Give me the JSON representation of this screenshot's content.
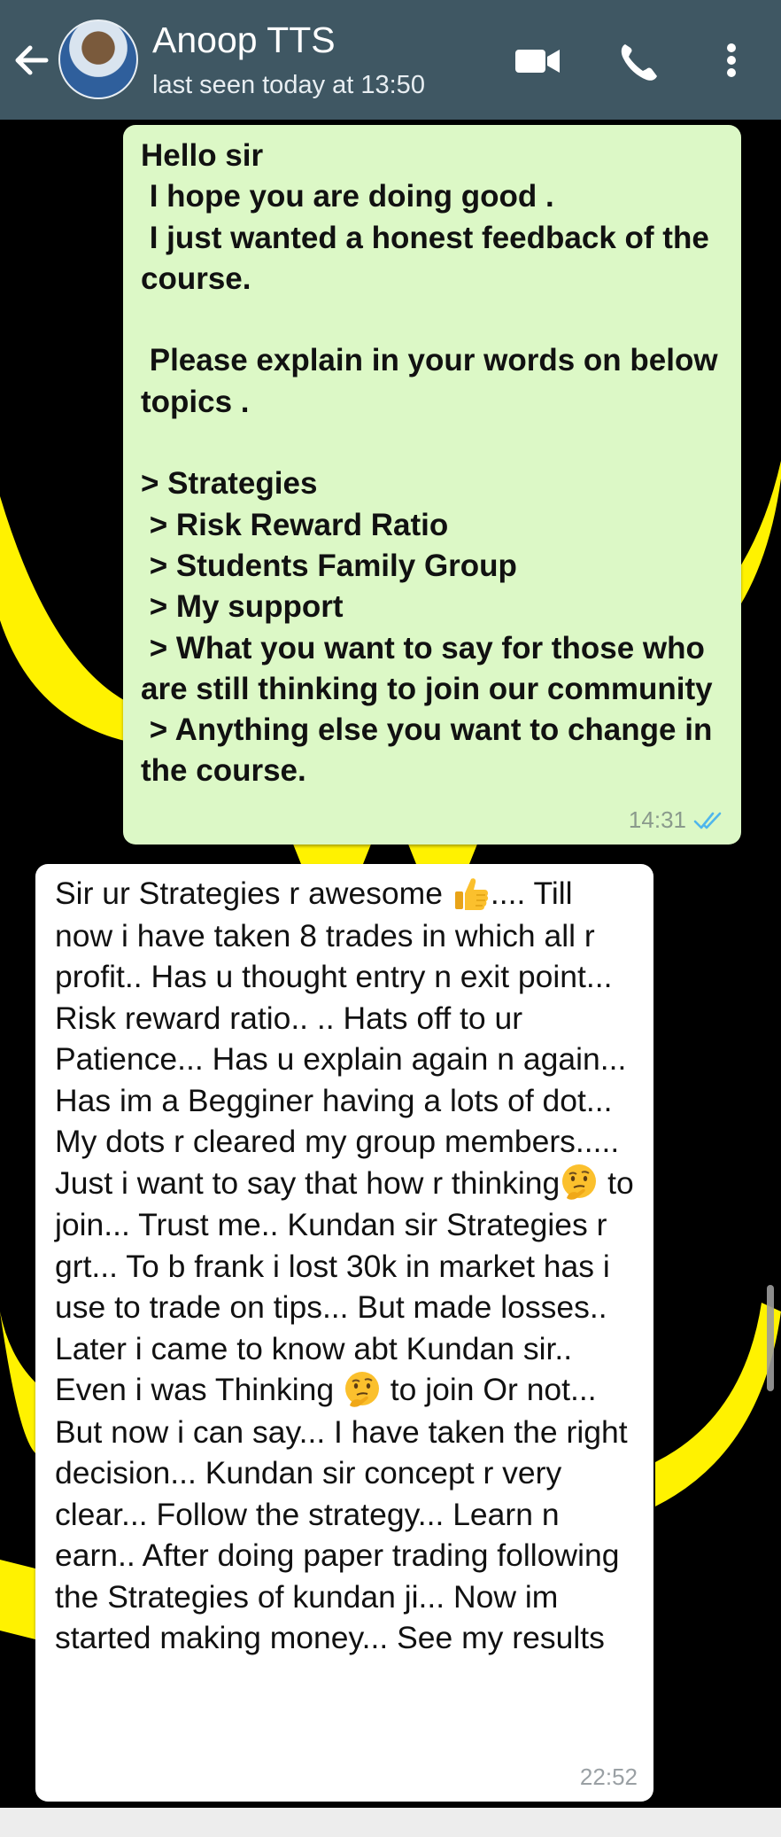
{
  "header": {
    "contact_name": "Anoop TTS",
    "last_seen": "last seen today at 13:50",
    "back_icon": "arrow-left-icon",
    "video_icon": "video-call-icon",
    "call_icon": "phone-icon",
    "menu_icon": "more-vertical-icon"
  },
  "colors": {
    "header_bg": "#3f5763",
    "outgoing_bubble": "#dcf8c6",
    "incoming_bubble": "#ffffff",
    "read_ticks": "#4fb6ec",
    "wallpaper_accent": "#fff200"
  },
  "messages": [
    {
      "direction": "outgoing",
      "text": "Hello sir\n I hope you are doing good .\n I just wanted a honest feedback of the course.\n\n Please explain in your words on below topics .\n\n> Strategies\n > Risk Reward Ratio\n > Students Family Group\n > My support\n > What you want to say for those who are still thinking to join our community\n > Anything else you want to change in the course.",
      "time": "14:31",
      "status": "read"
    },
    {
      "direction": "incoming",
      "text_parts": [
        "Sir ur Strategies r awesome ",
        ".... Till now i have taken 8 trades in which all r profit.. Has u thought entry n exit point... Risk reward ratio.. .. Hats off to ur Patience... Has u explain again n again... Has im a Begginer having a lots of dot... My dots r cleared my group members..... Just i want to say that how r thinking",
        " to join... Trust me.. Kundan sir Strategies r grt... To b frank i lost 30k in market has i use to trade on tips... But made losses.. Later i came to know abt Kundan sir.. Even i was Thinking ",
        " to join Or not... But now i can say... I have taken the right decision... Kundan sir concept r very clear... Follow the strategy... Learn n earn.. After doing paper trading following the Strategies of kundan ji... Now im started making money... See my results"
      ],
      "emojis": [
        "thumbs-up-emoji",
        "thinking-face-emoji",
        "thinking-face-emoji"
      ],
      "time": "22:52"
    }
  ]
}
